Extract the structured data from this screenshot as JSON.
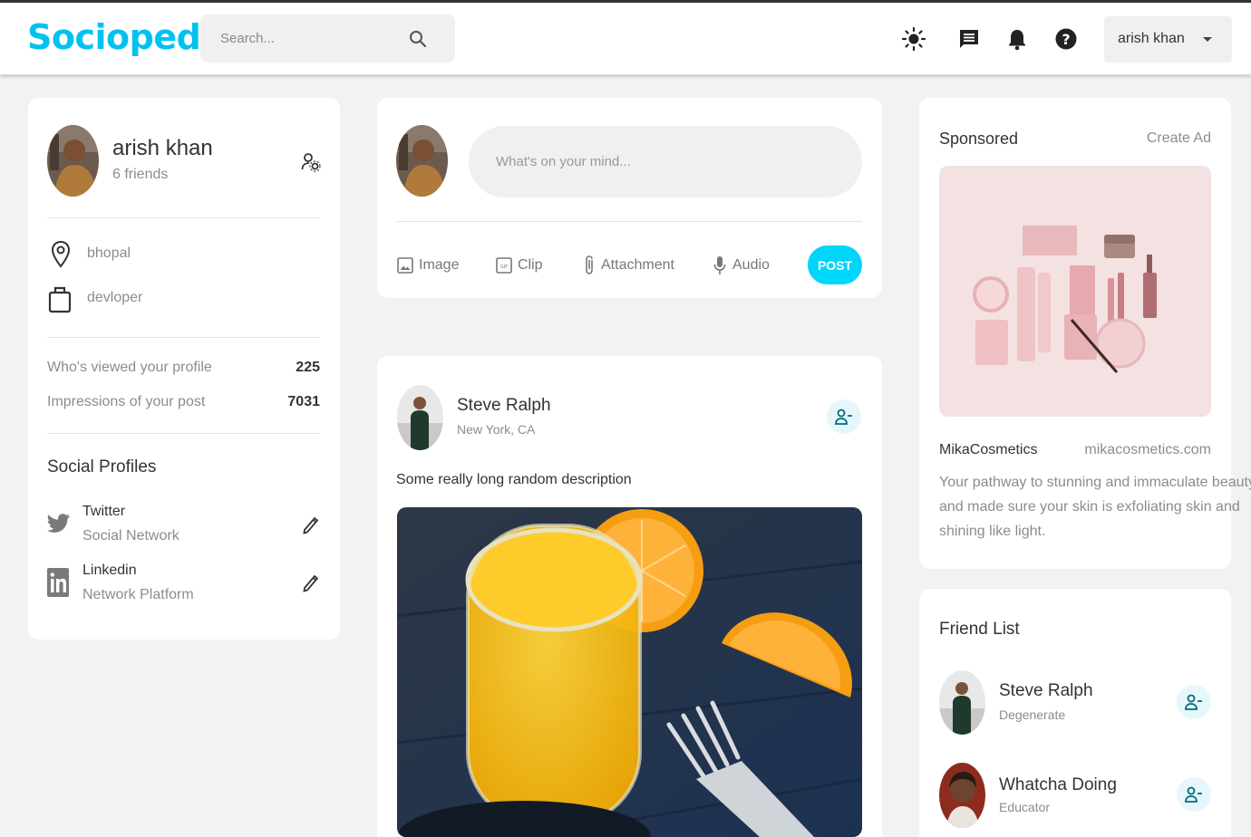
{
  "colors": {
    "brand": "#00d5fa",
    "brand_text": "#00c2ef",
    "accent_bg": "#e6f7fb",
    "page_bg": "#f2f2f2"
  },
  "navbar": {
    "logo": "Sociopedia",
    "search": {
      "placeholder": "Search..."
    },
    "icons": [
      "light-mode-icon",
      "message-icon",
      "notification-bell-icon",
      "help-icon"
    ],
    "user_select": "arish khan"
  },
  "profile": {
    "name": "arish khan",
    "friends": "6 friends",
    "location": "bhopal",
    "occupation": "devloper",
    "stats": [
      {
        "label": "Who's viewed your profile",
        "value": "225"
      },
      {
        "label": "Impressions of your post",
        "value": "7031"
      }
    ],
    "social_title": "Social Profiles",
    "social": [
      {
        "name": "Twitter",
        "type": "Social Network",
        "icon": "twitter-icon"
      },
      {
        "name": "Linkedin",
        "type": "Network Platform",
        "icon": "linkedin-icon"
      }
    ]
  },
  "composer": {
    "placeholder": "What's on your mind...",
    "options": [
      {
        "label": "Image",
        "icon": "image-icon"
      },
      {
        "label": "Clip",
        "icon": "gif-icon"
      },
      {
        "label": "Attachment",
        "icon": "attachment-icon"
      },
      {
        "label": "Audio",
        "icon": "microphone-icon"
      }
    ],
    "post_label": "POST"
  },
  "post": {
    "author": "Steve Ralph",
    "location": "New York, CA",
    "description": "Some really long random description"
  },
  "sponsored": {
    "title": "Sponsored",
    "create_ad": "Create Ad",
    "brand": "MikaCosmetics",
    "website": "mikacosmetics.com",
    "description_lines": [
      "Your pathway to stunning and immaculate beauty",
      "and made sure your skin is exfoliating skin and",
      "shining like light."
    ]
  },
  "friend_list": {
    "title": "Friend List",
    "friends": [
      {
        "name": "Steve Ralph",
        "occupation": "Degenerate"
      },
      {
        "name": "Whatcha Doing",
        "occupation": "Educator"
      }
    ]
  }
}
